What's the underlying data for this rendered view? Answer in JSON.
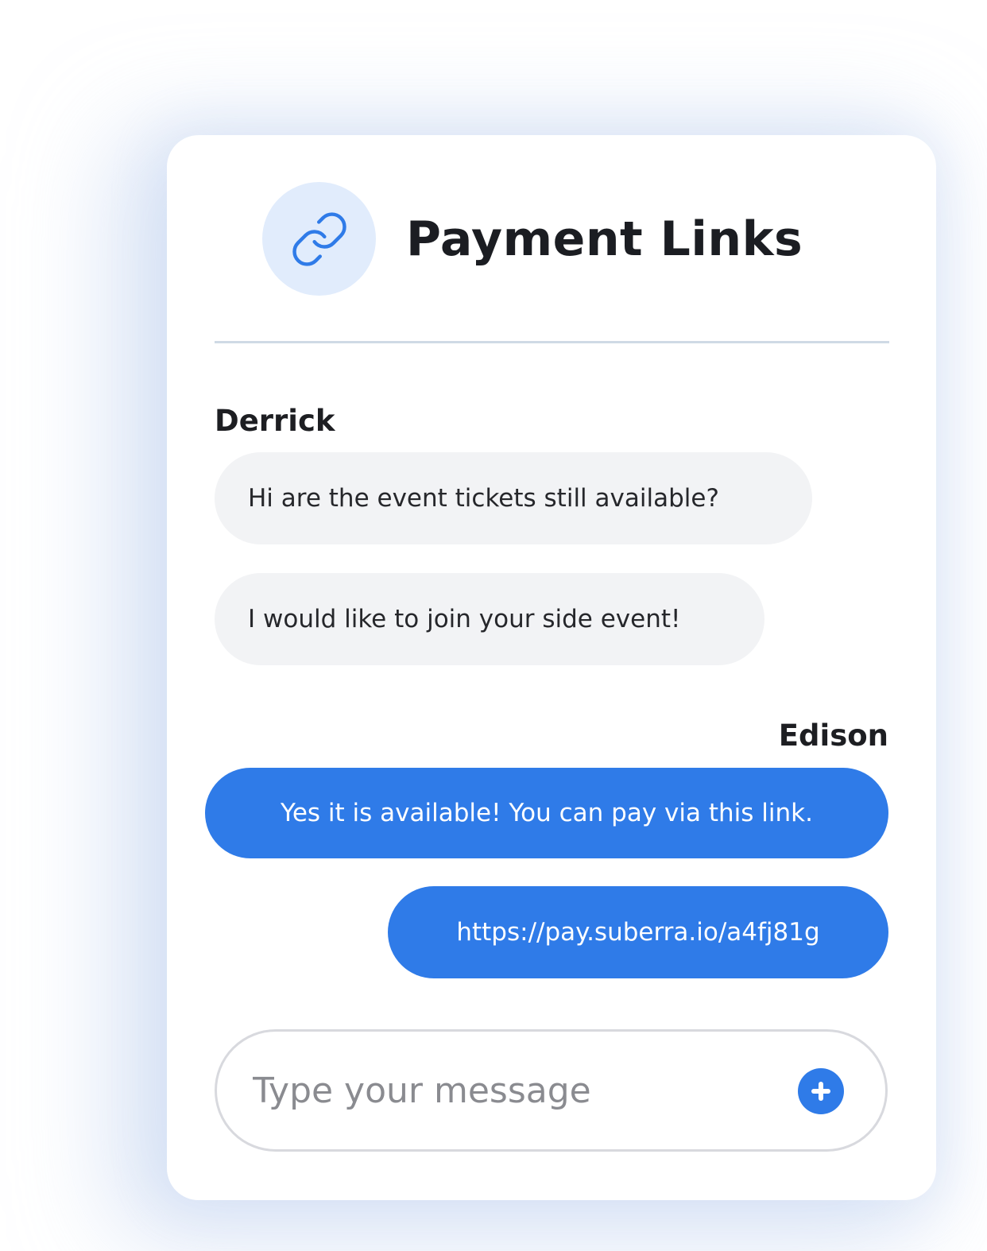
{
  "header": {
    "title": "Payment Links",
    "icon": "link-icon"
  },
  "colors": {
    "accent": "#2f7be8",
    "icon_bg": "#e1ecfc",
    "incoming_bubble": "#f2f3f5"
  },
  "conversation": {
    "incoming_sender": "Derrick",
    "incoming_messages": [
      "Hi are the event tickets still available?",
      "I would like to join your side event!"
    ],
    "outgoing_sender": "Edison",
    "outgoing_messages": [
      "Yes it is available! You can pay via this link.",
      "https://pay.suberra.io/a4fj81g"
    ]
  },
  "composer": {
    "placeholder": "Type your message",
    "value": "",
    "send_icon": "plus-icon"
  }
}
